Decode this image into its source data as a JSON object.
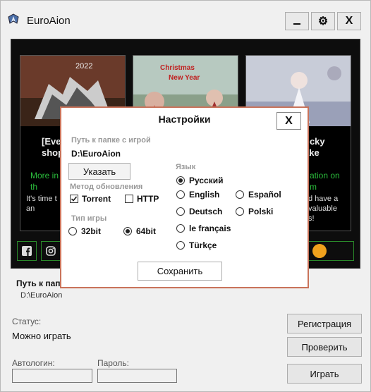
{
  "window": {
    "title": "EuroAion",
    "settings_label": "⚙",
    "close_label": "X"
  },
  "news": {
    "cards": [
      {
        "title": "[Eve\nshop",
        "subtitle": "More in\nth",
        "desc": "It's time t\nan"
      },
      {
        "title": "",
        "subtitle": "",
        "desc": ""
      },
      {
        "title": "ucky\nake",
        "subtitle": "ation on\nm",
        "desc": "d have a\nvaluable\ns!"
      }
    ]
  },
  "main": {
    "path_label": "Путь к папк",
    "path_value": "D:\\EuroAion",
    "status_label": "Статус:",
    "status_value": "Можно играть",
    "autologin_label": "Автологин:",
    "password_label": "Пароль:",
    "register_button": "Регистрация",
    "check_button": "Проверить",
    "play_button": "Играть"
  },
  "dialog": {
    "title": "Настройки",
    "close_label": "X",
    "path_label": "Путь к папке с игрой",
    "path_value": "D:\\EuroAion",
    "browse_button": "Указать",
    "update_method_label": "Метод обновления",
    "torrent_label": "Torrent",
    "torrent_checked": true,
    "http_label": "HTTP",
    "http_checked": false,
    "game_type_label": "Тип игры",
    "bit32_label": "32bit",
    "bit64_label": "64bit",
    "selected_bits": "64bit",
    "language_label": "Язык",
    "languages": [
      "Русский",
      "English",
      "Español",
      "Deutsch",
      "Polski",
      "le français",
      "Türkçe"
    ],
    "selected_language": "Русский",
    "save_button": "Сохранить"
  }
}
